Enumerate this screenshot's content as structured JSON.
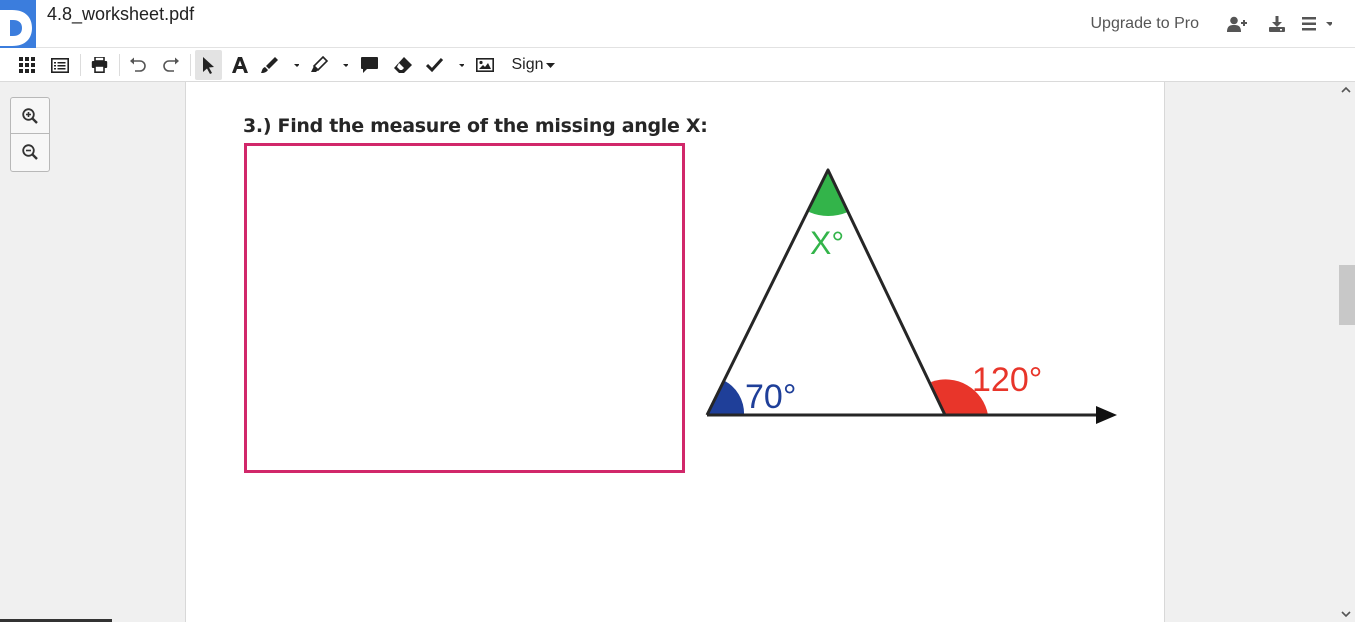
{
  "app": {
    "filename": "4.8_worksheet.pdf",
    "upgrade_label": "Upgrade to Pro",
    "icons": [
      "add-user-icon",
      "download-icon",
      "menu-icon"
    ]
  },
  "toolbar": {
    "sign_label": "Sign",
    "tools": [
      "thumbnails",
      "outline",
      "print",
      "undo",
      "redo",
      "select",
      "text",
      "draw",
      "highlight",
      "comment",
      "eraser",
      "checkmark",
      "image",
      "sign"
    ]
  },
  "zoom": {
    "zoom_in": "zoom-in-icon",
    "zoom_out": "zoom-out-icon"
  },
  "worksheet": {
    "question": "3.) Find the measure of the missing angle X:",
    "next_question_cutoff": "",
    "angle_top": "X°",
    "angle_left": "70°",
    "angle_exterior": "120°",
    "colors": {
      "top": "#33b44a",
      "left": "#1f3f99",
      "exterior": "#e8352a",
      "box": "#d1286a"
    }
  }
}
